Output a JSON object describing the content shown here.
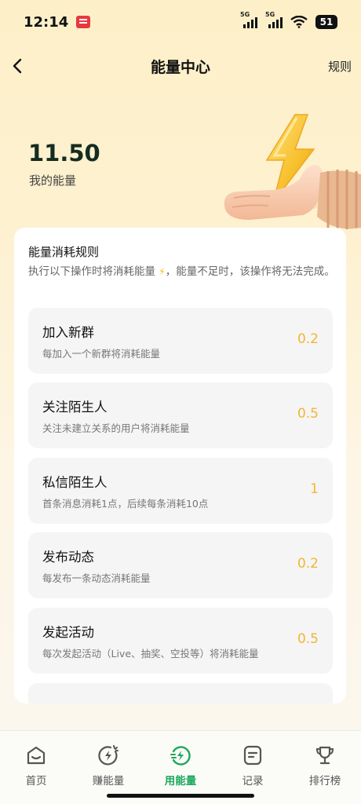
{
  "status": {
    "time": "12:14",
    "net1": "5G",
    "net2": "5G",
    "battery": "51"
  },
  "nav": {
    "title": "能量中心",
    "rules_label": "规则"
  },
  "energy": {
    "amount": "11.50",
    "label": "我的能量"
  },
  "rules_card": {
    "title": "能量消耗规则",
    "desc_prefix": "执行以下操作时将消耗能量 ",
    "desc_suffix": "，能量不足时，该操作将无法完成。",
    "items": [
      {
        "name": "加入新群",
        "desc": "每加入一个新群将消耗能量",
        "cost": "0.2"
      },
      {
        "name": "关注陌生人",
        "desc": "关注未建立关系的用户将消耗能量",
        "cost": "0.5"
      },
      {
        "name": "私信陌生人",
        "desc": "首条消息消耗1点，后续每条消耗10点",
        "cost": "1"
      },
      {
        "name": "发布动态",
        "desc": "每发布一条动态消耗能量",
        "cost": "0.2"
      },
      {
        "name": "发起活动",
        "desc": "每次发起活动（Live、抽奖、空投等）将消耗能量",
        "cost": "0.5"
      }
    ]
  },
  "tabs": [
    {
      "label": "首页",
      "icon": "home-icon",
      "active": false
    },
    {
      "label": "赚能量",
      "icon": "earn-energy-icon",
      "active": false
    },
    {
      "label": "用能量",
      "icon": "use-energy-icon",
      "active": true
    },
    {
      "label": "记录",
      "icon": "record-icon",
      "active": false
    },
    {
      "label": "排行榜",
      "icon": "trophy-icon",
      "active": false
    }
  ],
  "colors": {
    "accent_green": "#1ea85c",
    "cost_yellow": "#f2b632",
    "energy_text": "#142c22"
  }
}
